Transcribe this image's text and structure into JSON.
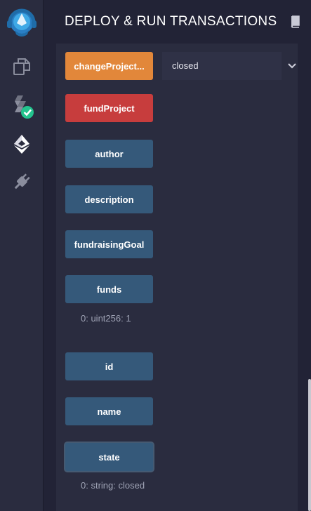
{
  "header": {
    "title": "DEPLOY & RUN TRANSACTIONS"
  },
  "sidebar": {
    "icons": [
      "remix-logo-icon",
      "file-explorer-icon",
      "solidity-compiler-icon",
      "deploy-run-icon",
      "plugin-manager-icon"
    ]
  },
  "contract": {
    "change_project": {
      "label": "changeProject...",
      "input_value": "closed"
    },
    "fund_project": {
      "label": "fundProject"
    },
    "author": {
      "label": "author"
    },
    "description": {
      "label": "description"
    },
    "fundraising_goal": {
      "label": "fundraisingGoal"
    },
    "funds": {
      "label": "funds",
      "result": "0: uint256: 1"
    },
    "id": {
      "label": "id"
    },
    "name": {
      "label": "name"
    },
    "state": {
      "label": "state",
      "result": "0: string: closed"
    }
  },
  "colors": {
    "call_button": "#35597a",
    "payable_button": "#c73d3d",
    "transact_button": "#e2873a",
    "accent": "#2fb5e8",
    "success": "#23c48e"
  }
}
